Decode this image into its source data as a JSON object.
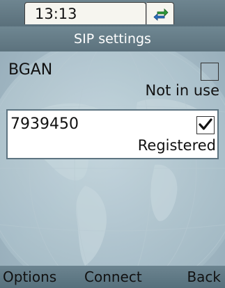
{
  "status_bar": {
    "time": "13:13",
    "connection_icon": "sync-arrows-icon"
  },
  "title": "SIP settings",
  "accounts": [
    {
      "name": "BGAN",
      "status": "Not in use",
      "checked": false
    },
    {
      "name": "7939450",
      "status": "Registered",
      "checked": true
    }
  ],
  "softkeys": {
    "left": "Options",
    "middle": "Connect",
    "right": "Back"
  },
  "colors": {
    "bar": "#5f7681",
    "background": "#a9bec8",
    "selection": "#ffffff",
    "icon_green": "#2e9a3a",
    "icon_blue": "#2a6fbf"
  }
}
